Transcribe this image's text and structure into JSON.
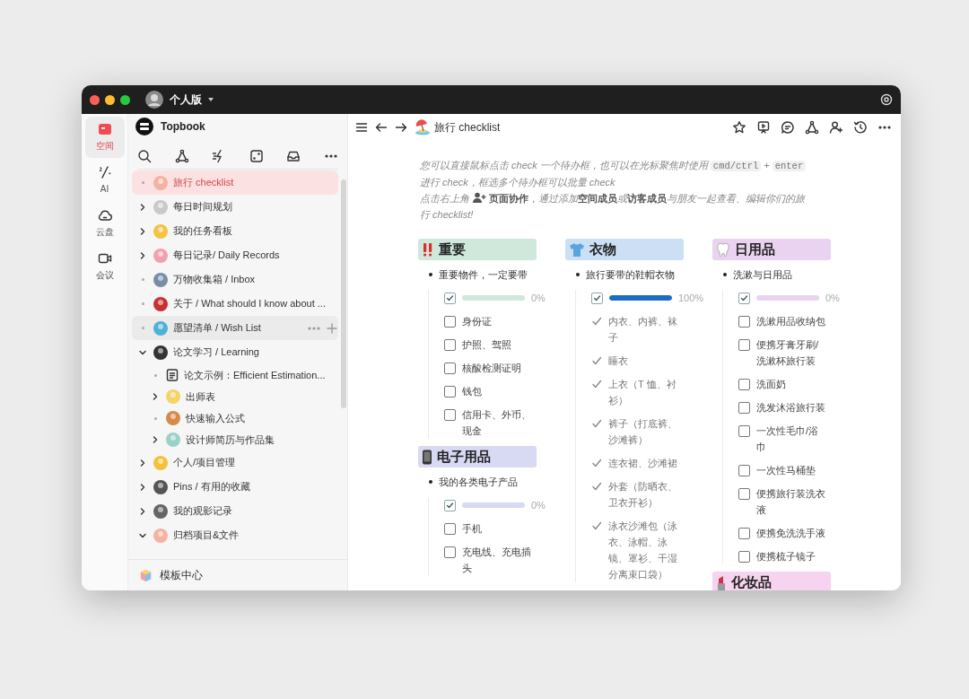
{
  "window": {
    "title": "个人版"
  },
  "rail": [
    {
      "label": "空间",
      "selected": true
    },
    {
      "label": "AI",
      "selected": false
    },
    {
      "label": "云盘",
      "selected": false
    },
    {
      "label": "会议",
      "selected": false
    }
  ],
  "sidebar": {
    "workspace": "Topbook",
    "items": [
      {
        "label": "旅行 checklist",
        "kind": "page",
        "expandable": false,
        "selected": true,
        "hovered": false
      },
      {
        "label": "每日时间规划",
        "kind": "page",
        "expandable": true,
        "expanded": false,
        "selected": false,
        "hovered": false
      },
      {
        "label": "我的任务看板",
        "kind": "page",
        "expandable": true,
        "expanded": false,
        "selected": false,
        "hovered": false
      },
      {
        "label": "每日记录/ Daily Records",
        "kind": "page",
        "expandable": true,
        "expanded": false,
        "selected": false,
        "hovered": false
      },
      {
        "label": "万物收集箱 / Inbox",
        "kind": "page",
        "expandable": false,
        "selected": false,
        "hovered": false
      },
      {
        "label": "关于 / What should I know about ...",
        "kind": "page",
        "expandable": false,
        "selected": false,
        "hovered": false
      },
      {
        "label": "愿望清单 / Wish List",
        "kind": "page",
        "expandable": false,
        "selected": false,
        "hovered": true
      },
      {
        "label": "论文学习 / Learning",
        "kind": "page",
        "expandable": true,
        "expanded": true,
        "selected": false,
        "hovered": false,
        "children": [
          {
            "label": "论文示例：Efficient Estimation...",
            "kind": "document",
            "expandable": false,
            "selected": false,
            "hovered": false
          },
          {
            "label": "出师表",
            "kind": "page",
            "expandable": true,
            "expanded": false,
            "selected": false,
            "hovered": false
          },
          {
            "label": "快速输入公式",
            "kind": "page",
            "expandable": false,
            "selected": false,
            "hovered": false
          },
          {
            "label": "设计师简历与作品集",
            "kind": "page",
            "expandable": true,
            "expanded": false,
            "selected": false,
            "hovered": false
          }
        ]
      },
      {
        "label": "个人/项目管理",
        "kind": "page",
        "expandable": true,
        "expanded": false,
        "selected": false,
        "hovered": false
      },
      {
        "label": "Pins / 有用的收藏",
        "kind": "page",
        "expandable": true,
        "expanded": false,
        "selected": false,
        "hovered": false
      },
      {
        "label": "我的观影记录",
        "kind": "page",
        "expandable": true,
        "expanded": false,
        "selected": false,
        "hovered": false
      },
      {
        "label": "归档项目&文件",
        "kind": "page",
        "expandable": true,
        "expanded": true,
        "selected": false,
        "hovered": false
      }
    ],
    "footer": "模板中心"
  },
  "page": {
    "title": "旅行 checklist",
    "intro": [
      [
        {
          "kind": "text",
          "text": "您可以直接鼠标点击 check 一个待办框，也可以在光标聚焦时使用"
        },
        {
          "kind": "code",
          "text": "cmd/ctrl"
        },
        {
          "kind": "text",
          "text": "+"
        },
        {
          "kind": "code",
          "text": "enter"
        }
      ],
      [
        {
          "kind": "text",
          "text": "进行 check，框选多个待办框可以批量 check"
        }
      ],
      [
        {
          "kind": "text",
          "text": "点击右上角"
        },
        {
          "kind": "icon"
        },
        {
          "kind": "text",
          "text": "**页面协作**，通过添加**空间成员**或**访客成员**与朋友一起查看、编辑你们的旅"
        }
      ],
      [
        {
          "kind": "text",
          "text": "行 checklist!"
        }
      ]
    ],
    "columns": [
      {
        "blocks": [
          {
            "title": "重要",
            "color": "#cfe8dc",
            "note": "重要物件，一定要带",
            "progress": {
              "checked": true,
              "level": 0,
              "reading": "0%"
            },
            "items": [
              {
                "label": "身份证",
                "checked": false
              },
              {
                "label": "护照、驾照",
                "checked": false
              },
              {
                "label": "核酸检测证明",
                "checked": false
              },
              {
                "label": "钱包",
                "checked": false
              },
              {
                "label": "信用卡、外币、现金",
                "checked": false
              }
            ]
          },
          {
            "title": "电子用品",
            "color": "#d8d9f3",
            "note": "我的各类电子产品",
            "progress": {
              "checked": true,
              "level": 0,
              "reading": "0%"
            },
            "items": [
              {
                "label": "手机",
                "checked": false
              },
              {
                "label": "充电线、充电插头",
                "checked": false
              }
            ]
          }
        ]
      },
      {
        "blocks": [
          {
            "title": "衣物",
            "color": "#cbe0f4",
            "note": "旅行要带的鞋帽衣物",
            "progress": {
              "checked": true,
              "level": 1,
              "reading": "100%"
            },
            "items": [
              {
                "label": "内衣、内裤、袜子",
                "checked": true
              },
              {
                "label": "睡衣",
                "checked": true
              },
              {
                "label": "上衣（T 恤、衬衫）",
                "checked": true
              },
              {
                "label": "裤子（打底裤、沙滩裤）",
                "checked": true
              },
              {
                "label": "连衣裙、沙滩裙",
                "checked": true
              },
              {
                "label": "外套（防晒衣、卫衣开衫）",
                "checked": true
              },
              {
                "label": "泳衣沙滩包（泳衣、泳帽、泳镜、罩衫、干湿分离束口袋）",
                "checked": true
              }
            ]
          }
        ]
      },
      {
        "blocks": [
          {
            "title": "日用品",
            "color": "#ead3f0",
            "note": "洗漱与日用品",
            "progress": {
              "checked": true,
              "level": 0,
              "reading": "0%"
            },
            "items": [
              {
                "label": "洗漱用品收纳包",
                "checked": false
              },
              {
                "label": "便携牙膏牙刷/洗漱杯旅行装",
                "checked": false
              },
              {
                "label": "洗面奶",
                "checked": false
              },
              {
                "label": "洗发沐浴旅行装",
                "checked": false
              },
              {
                "label": "一次性毛巾/浴巾",
                "checked": false
              },
              {
                "label": "一次性马桶垫",
                "checked": false
              },
              {
                "label": "便携旅行装洗衣液",
                "checked": false
              },
              {
                "label": "便携免洗洗手液",
                "checked": false
              },
              {
                "label": "便携梳子镜子",
                "checked": false
              }
            ]
          },
          {
            "title": "化妆品",
            "color": "#f6d3ee"
          }
        ]
      }
    ]
  }
}
